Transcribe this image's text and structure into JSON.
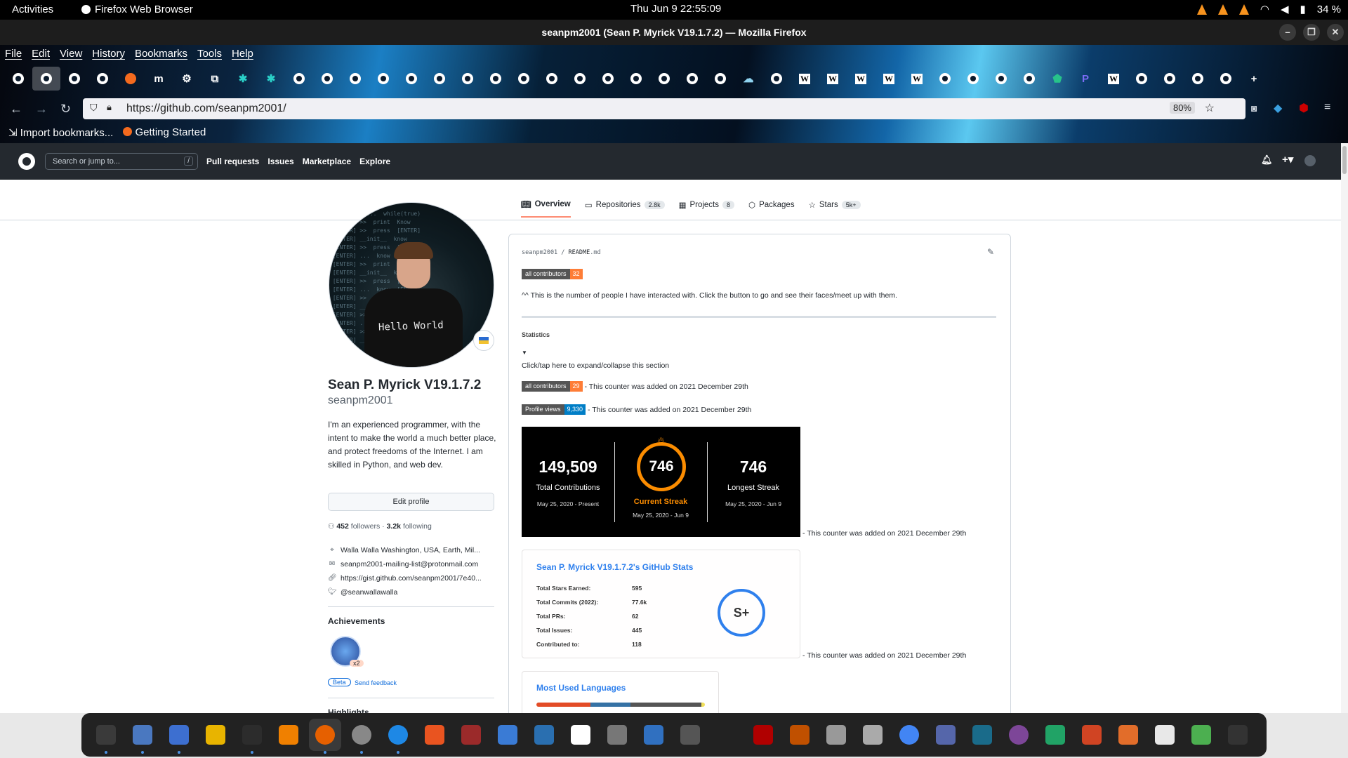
{
  "system": {
    "activities": "Activities",
    "app_name": "Firefox Web Browser",
    "clock": "Thu Jun 9  22:55:09",
    "battery": "34 %"
  },
  "window": {
    "title": "seanpm2001 (Sean P. Myrick V19.1.7.2) — Mozilla Firefox"
  },
  "menu": [
    "File",
    "Edit",
    "View",
    "History",
    "Bookmarks",
    "Tools",
    "Help"
  ],
  "tab_icons": [
    "github",
    "github",
    "github",
    "github",
    "firefox",
    "m",
    "gear",
    "puzzle",
    "teal-star",
    "teal-star",
    "github",
    "github",
    "github",
    "github",
    "github",
    "github",
    "github",
    "github",
    "github",
    "github",
    "github",
    "github",
    "github",
    "github",
    "github",
    "github",
    "cloud",
    "github",
    "wikipedia",
    "wikipedia",
    "wikipedia",
    "wikipedia",
    "wikipedia",
    "github",
    "github",
    "github",
    "github",
    "shield-check",
    "p",
    "wikipedia",
    "github",
    "github",
    "github",
    "github"
  ],
  "tab_icon_glyphs": {
    "m": "m",
    "p": "P",
    "wikipedia": "W",
    "plus": "+"
  },
  "address": {
    "url": "https://github.com/seanpm2001/",
    "zoom": "80%"
  },
  "bookmarks": [
    "Import bookmarks...",
    "Getting Started"
  ],
  "github": {
    "search_placeholder": "Search or jump to...",
    "search_key": "/",
    "nav": [
      "Pull requests",
      "Issues",
      "Marketplace",
      "Explore"
    ]
  },
  "profile_tabs": [
    {
      "label": "Overview",
      "count": ""
    },
    {
      "label": "Repositories",
      "count": "2.8k"
    },
    {
      "label": "Projects",
      "count": "8"
    },
    {
      "label": "Packages",
      "count": ""
    },
    {
      "label": "Stars",
      "count": "5k+"
    }
  ],
  "profile": {
    "name": "Sean P. Myrick V19.1.7.2",
    "login": "seanpm2001",
    "bio": "I'm an experienced programmer, with the intent to make the world a much better place, and protect freedoms of the Internet. I am skilled in Python, and web dev.",
    "edit_button": "Edit profile",
    "followers": "452",
    "followers_label": "followers",
    "following": "3.2k",
    "following_label": "following",
    "location": "Walla Walla Washington, USA, Earth, Mil...",
    "email": "seanpm2001-mailing-list@protonmail.com",
    "website": "https://gist.github.com/seanpm2001/7e40...",
    "twitter": "@seanwallawalla",
    "achievements_title": "Achievements",
    "achievement_count": "x2",
    "beta_label": "Beta",
    "feedback_link": "Send feedback",
    "highlights_title": "Highlights"
  },
  "readme": {
    "user": "seanpm2001",
    "sep": " / ",
    "file": "README",
    "ext": ".md",
    "badge_contrib_label": "all contributors",
    "badge_contrib_value": "32",
    "intro": "^^ This is the number of people I have interacted with. Click the button to go and see their faces/meet up with them.",
    "statistics_heading": "Statistics",
    "triangle": "▼",
    "expand_text": "Click/tap here to expand/collapse this section",
    "badge2_label": "all contributors",
    "badge2_value": "29",
    "counter_note": "- This counter was added on 2021 December 29th",
    "views_label": "Profile views",
    "views_value": "9,330"
  },
  "streak": {
    "total": "149,509",
    "total_label": "Total Contributions",
    "total_range": "May 25, 2020 - Present",
    "current": "746",
    "current_label": "Current Streak",
    "current_range": "May 25, 2020 - Jun 9",
    "longest": "746",
    "longest_label": "Longest Streak",
    "longest_range": "May 25, 2020 - Jun 9"
  },
  "stats_card": {
    "title": "Sean P. Myrick V19.1.7.2's GitHub Stats",
    "rows": [
      {
        "k": "Total Stars Earned:",
        "v": "595"
      },
      {
        "k": "Total Commits (2022):",
        "v": "77.6k"
      },
      {
        "k": "Total PRs:",
        "v": "62"
      },
      {
        "k": "Total Issues:",
        "v": "445"
      },
      {
        "k": "Contributed to:",
        "v": "118"
      }
    ],
    "grade": "S+"
  },
  "langs_card": {
    "title": "Most Used Languages",
    "bar_colors": [
      "#e34c26",
      "#3572A5",
      "#555555",
      "#f1e05a"
    ],
    "bar_shares": [
      0.32,
      0.24,
      0.42,
      0.02
    ]
  },
  "dock_apps": [
    "system-monitor",
    "files",
    "text-editor",
    "notes",
    "terminal",
    "vlc",
    "firefox",
    "settings",
    "help",
    "app-store",
    "monitor",
    "editor",
    "tweaks",
    "document",
    "media",
    "virtualbox",
    "camera",
    "inkscape",
    "car",
    "game",
    "archive",
    "image-viewer",
    "chrome",
    "typora",
    "book",
    "tor",
    "spreadsheet",
    "presentation",
    "slides",
    "draw",
    "trash",
    "app-grid"
  ],
  "dock_colors": [
    "#3a3a3a",
    "#4a78c0",
    "#3d6fd0",
    "#e8b400",
    "#2c2c2c",
    "#f08000",
    "#e66000",
    "#888888",
    "#1e88e5",
    "#e95420",
    "#9b2a2a",
    "#3a7bd5",
    "#2a6fb0",
    "#ffffff",
    "#777777",
    "#3070c0",
    "#555555",
    "#222222",
    "#b00000",
    "#c05000",
    "#999999",
    "#aaaaaa",
    "#4285f4",
    "#5566aa",
    "#1a6b8a",
    "#7d4698",
    "#21a366",
    "#d04423",
    "#e26d2a",
    "#e8e8e8",
    "#4caf50",
    "#333333"
  ]
}
